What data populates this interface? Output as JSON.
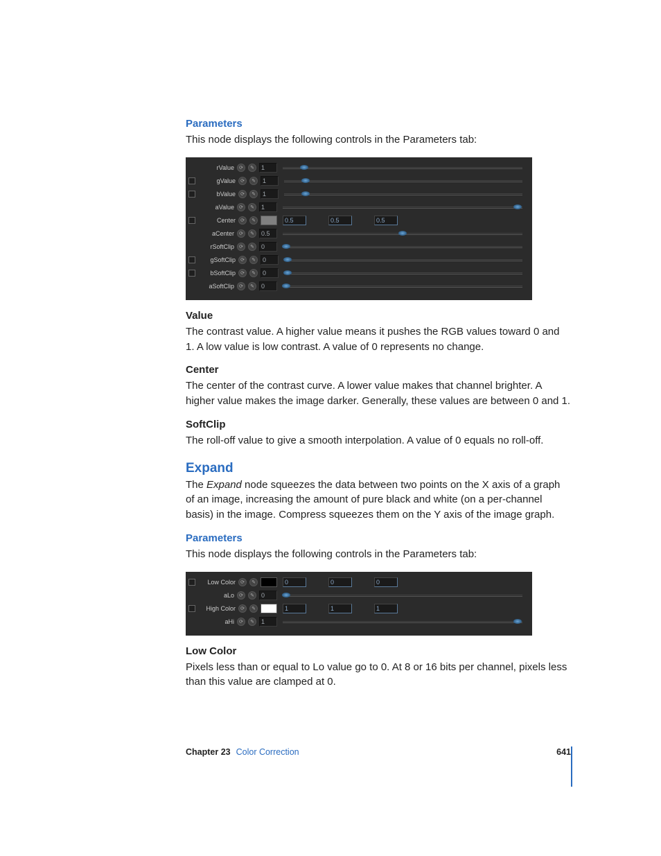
{
  "section1": {
    "heading": "Parameters",
    "intro": "This node displays the following controls in the Parameters tab:"
  },
  "panel1": {
    "rows": [
      {
        "toggle": false,
        "label": "rValue",
        "value": "1",
        "handle": 9
      },
      {
        "toggle": true,
        "label": "gValue",
        "value": "1",
        "handle": 9
      },
      {
        "toggle": true,
        "label": "bValue",
        "value": "1",
        "handle": 9
      },
      {
        "toggle": false,
        "label": "aValue",
        "value": "1",
        "handle": 98
      },
      {
        "toggle": true,
        "label": "Center",
        "swatch": "#808080",
        "triplet": [
          "0.5",
          "0.5",
          "0.5"
        ]
      },
      {
        "toggle": false,
        "label": "aCenter",
        "value": "0.5",
        "handle": 50
      },
      {
        "toggle": false,
        "label": "rSoftClip",
        "value": "0",
        "handle": 1.5
      },
      {
        "toggle": true,
        "label": "gSoftClip",
        "value": "0",
        "handle": 1.5
      },
      {
        "toggle": true,
        "label": "bSoftClip",
        "value": "0",
        "handle": 1.5
      },
      {
        "toggle": false,
        "label": "aSoftClip",
        "value": "0",
        "handle": 1.5
      }
    ]
  },
  "subs1": [
    {
      "title": "Value",
      "body": "The contrast value. A higher value means it pushes the RGB values toward 0 and 1. A low value is low contrast. A value of 0 represents no change."
    },
    {
      "title": "Center",
      "body": "The center of the contrast curve. A lower value makes that channel brighter. A higher value makes the image darker. Generally, these values are between 0 and 1."
    },
    {
      "title": "SoftClip",
      "body": "The roll-off value to give a smooth interpolation. A value of 0 equals no roll-off."
    }
  ],
  "expand": {
    "heading": "Expand",
    "body_prefix": "The ",
    "body_em": "Expand",
    "body_suffix": " node squeezes the data between two points on the X axis of a graph of an image, increasing the amount of pure black and white (on a per-channel basis) in the image. Compress squeezes them on the Y axis of the image graph."
  },
  "section2": {
    "heading": "Parameters",
    "intro": "This node displays the following controls in the Parameters tab:"
  },
  "panel2": {
    "rows": [
      {
        "toggle": true,
        "label": "Low Color",
        "swatch": "#000000",
        "triplet": [
          "0",
          "0",
          "0"
        ]
      },
      {
        "toggle": false,
        "label": "aLo",
        "value": "0",
        "handle": 1.5
      },
      {
        "toggle": true,
        "label": "High Color",
        "swatch": "#ffffff",
        "triplet": [
          "1",
          "1",
          "1"
        ]
      },
      {
        "toggle": false,
        "label": "aHi",
        "value": "1",
        "handle": 98
      }
    ]
  },
  "subs2": [
    {
      "title": "Low Color",
      "body": "Pixels less than or equal to Lo value go to 0. At 8 or 16 bits per channel, pixels less than this value are clamped at 0."
    }
  ],
  "footer": {
    "chapter": "Chapter 23",
    "name": "Color Correction",
    "page": "641"
  }
}
